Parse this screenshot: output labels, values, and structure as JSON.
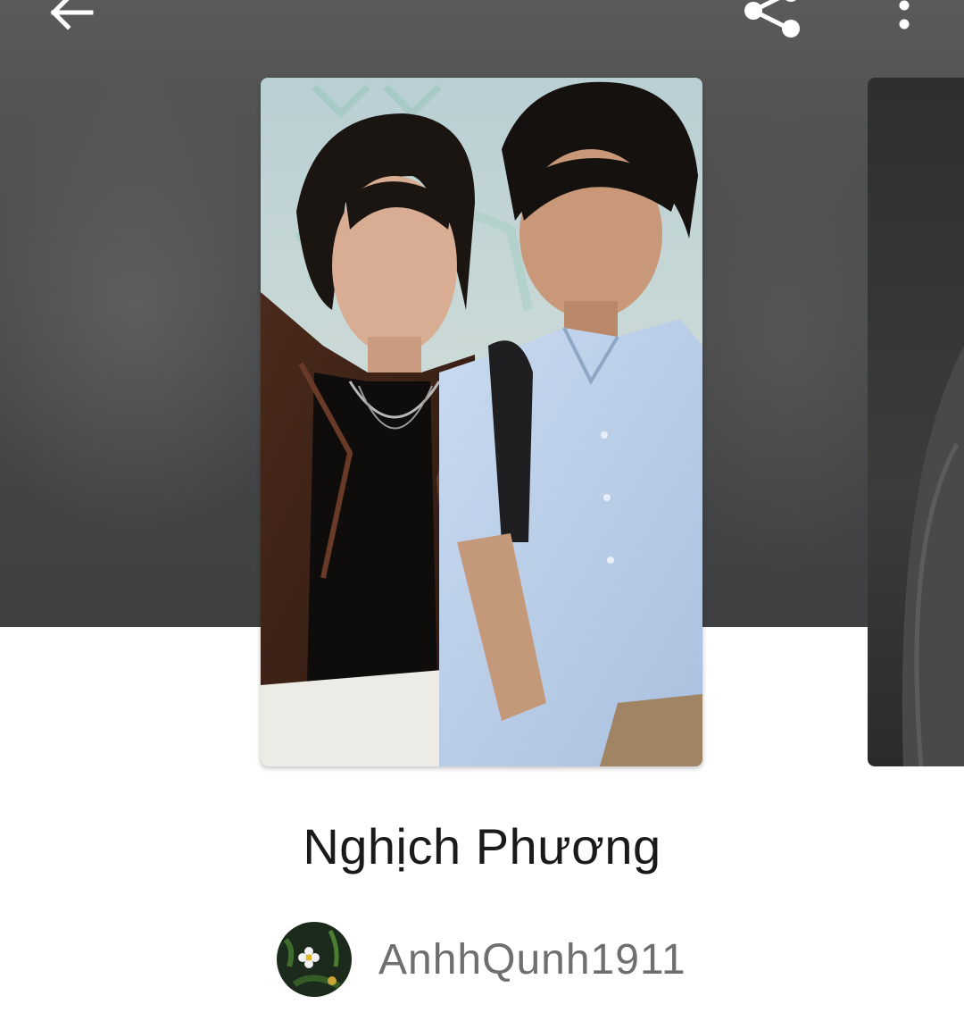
{
  "toolbar": {
    "back_icon": "arrow-left-icon",
    "share_icon": "share-icon",
    "more_icon": "more-vertical-icon"
  },
  "story": {
    "title": "Nghịch Phương",
    "author": "AnhhQunh1911",
    "cover_icon": "book-cover-image",
    "avatar_icon": "author-avatar"
  },
  "colors": {
    "hero_background": "#4a4b4c",
    "title_text": "#1a1a1a",
    "author_text": "#6f6f6f"
  }
}
